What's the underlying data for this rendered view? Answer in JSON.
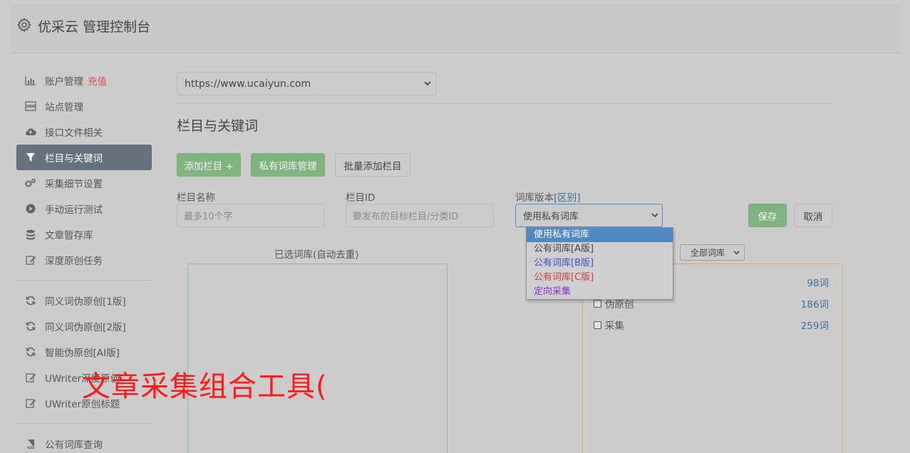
{
  "header": {
    "title": "优采云 管理控制台",
    "icon": "gear-icon"
  },
  "sidebar": {
    "group1": [
      {
        "label": "账户管理",
        "badge": "充值",
        "icon": "bar-chart-icon"
      },
      {
        "label": "站点管理",
        "icon": "server-icon"
      },
      {
        "label": "接口文件相关",
        "icon": "cloud-upload-icon"
      },
      {
        "label": "栏目与关键词",
        "icon": "filter-icon",
        "active": true
      },
      {
        "label": "采集细节设置",
        "icon": "cogs-icon"
      },
      {
        "label": "手动运行测试",
        "icon": "play-circle-icon"
      },
      {
        "label": "文章暂存库",
        "icon": "database-icon"
      },
      {
        "label": "深度原创任务",
        "icon": "edit-icon"
      }
    ],
    "group2": [
      {
        "label": "同义词伪原创[1版]",
        "icon": "refresh-icon"
      },
      {
        "label": "同义词伪原创[2版]",
        "icon": "refresh-icon"
      },
      {
        "label": "智能伪原创[AI版]",
        "icon": "refresh-icon"
      },
      {
        "label": "UWriter深度原创",
        "icon": "edit-icon"
      },
      {
        "label": "UWriter原创标题",
        "icon": "edit-icon"
      }
    ],
    "group3": [
      {
        "label": "公有词库查询",
        "icon": "book-icon"
      }
    ]
  },
  "main": {
    "site_select_value": "https://www.ucaiyun.com",
    "section_title": "栏目与关键词",
    "buttons": {
      "add_column": "添加栏目 +",
      "private_lib": "私有词库管理",
      "batch_add": "批量添加栏目",
      "save": "保存",
      "cancel": "取消"
    },
    "form": {
      "name_label": "栏目名称",
      "name_placeholder": "最多10个字",
      "id_label": "栏目ID",
      "id_placeholder": "要发布的目标栏目/分类ID",
      "version_label": "词库版本",
      "version_link": "[区别]",
      "version_value": "使用私有词库"
    },
    "dropdown_options": [
      {
        "label": "使用私有词库",
        "color": "#ffffff",
        "selected": true
      },
      {
        "label": "公有词库[A版]",
        "color": "#444444"
      },
      {
        "label": "公有词库[B版]",
        "color": "#3b4fd0"
      },
      {
        "label": "公有词库[C版]",
        "color": "#c9423c"
      },
      {
        "label": "定向采集",
        "color": "#8a2be2"
      }
    ],
    "selected_libs_title": "已选词库(自动去重)",
    "all_libs_select": "全部词库",
    "libs": [
      {
        "label": "",
        "count": "98词"
      },
      {
        "label": "伪原创",
        "count": "186词"
      },
      {
        "label": "采集",
        "count": "259词"
      }
    ]
  },
  "overlay": {
    "text": "文章采集组合工具("
  }
}
